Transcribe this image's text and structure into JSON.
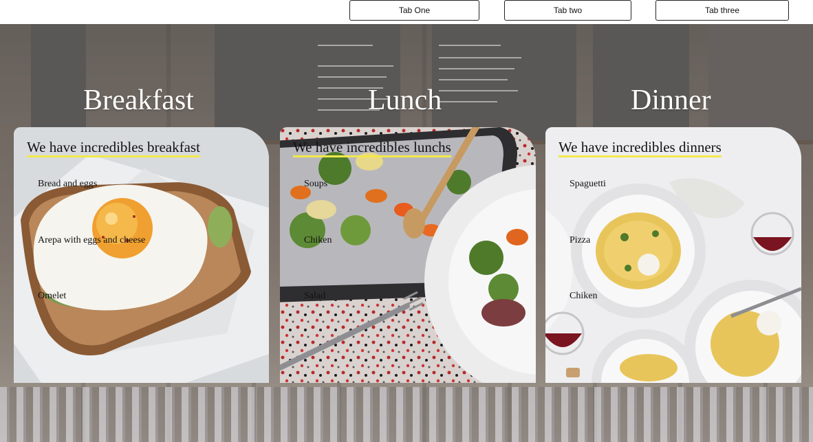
{
  "tabs": [
    {
      "label": "Tab One"
    },
    {
      "label": "Tab two"
    },
    {
      "label": "Tab three"
    }
  ],
  "sections": [
    {
      "title": "Breakfast",
      "heading": "We have incredibles breakfast",
      "items": [
        "Bread and eggs",
        "Arepa with eggs and cheese",
        "Omelet"
      ]
    },
    {
      "title": "Lunch",
      "heading": "We have incredibles lunchs",
      "items": [
        "Soups",
        "Chiken",
        "Salad"
      ]
    },
    {
      "title": "Dinner",
      "heading": "We have incredibles dinners",
      "items": [
        "Spaguetti",
        "Pizza",
        "Chiken"
      ]
    }
  ],
  "colors": {
    "heading_underline": "#f1e94a",
    "title_text": "#ffffff",
    "tab_border": "#222222"
  }
}
